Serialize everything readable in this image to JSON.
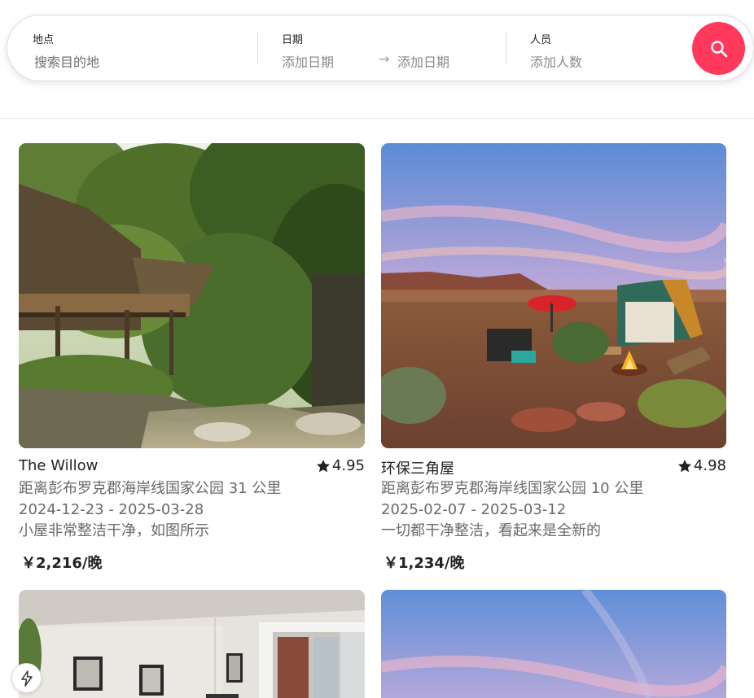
{
  "search": {
    "where_label": "地点",
    "where_placeholder": "搜索目的地",
    "dates_label": "日期",
    "checkin_placeholder": "添加日期",
    "arrow": "→",
    "checkout_placeholder": "添加日期",
    "who_label": "人员",
    "who_placeholder": "添加人数",
    "button_icon": "search-icon",
    "accent_color": "#ff385c"
  },
  "listings": [
    {
      "title": "The Willow",
      "rating": "4.95",
      "distance": "距离彭布罗克郡海岸线国家公园 31 公里",
      "dates": "2024-12-23 - 2025-03-28",
      "review": "小屋非常整洁干净，如图所示",
      "price": "￥2,216/晚",
      "photo": "treehouse-in-forest"
    },
    {
      "title": "环保三角屋",
      "rating": "4.98",
      "distance": "距离彭布罗克郡海岸线国家公园 10 公里",
      "dates": "2025-02-07 - 2025-03-12",
      "review": "一切都干净整洁，看起来是全新的",
      "price": "￥1,234/晚",
      "photo": "a-frame-cabin-desert-sunset"
    },
    {
      "photo": "apartment-living-room"
    },
    {
      "photo": "sunset-sky"
    }
  ],
  "icons": {
    "rating": "star-icon",
    "floating": "lightning-icon"
  }
}
